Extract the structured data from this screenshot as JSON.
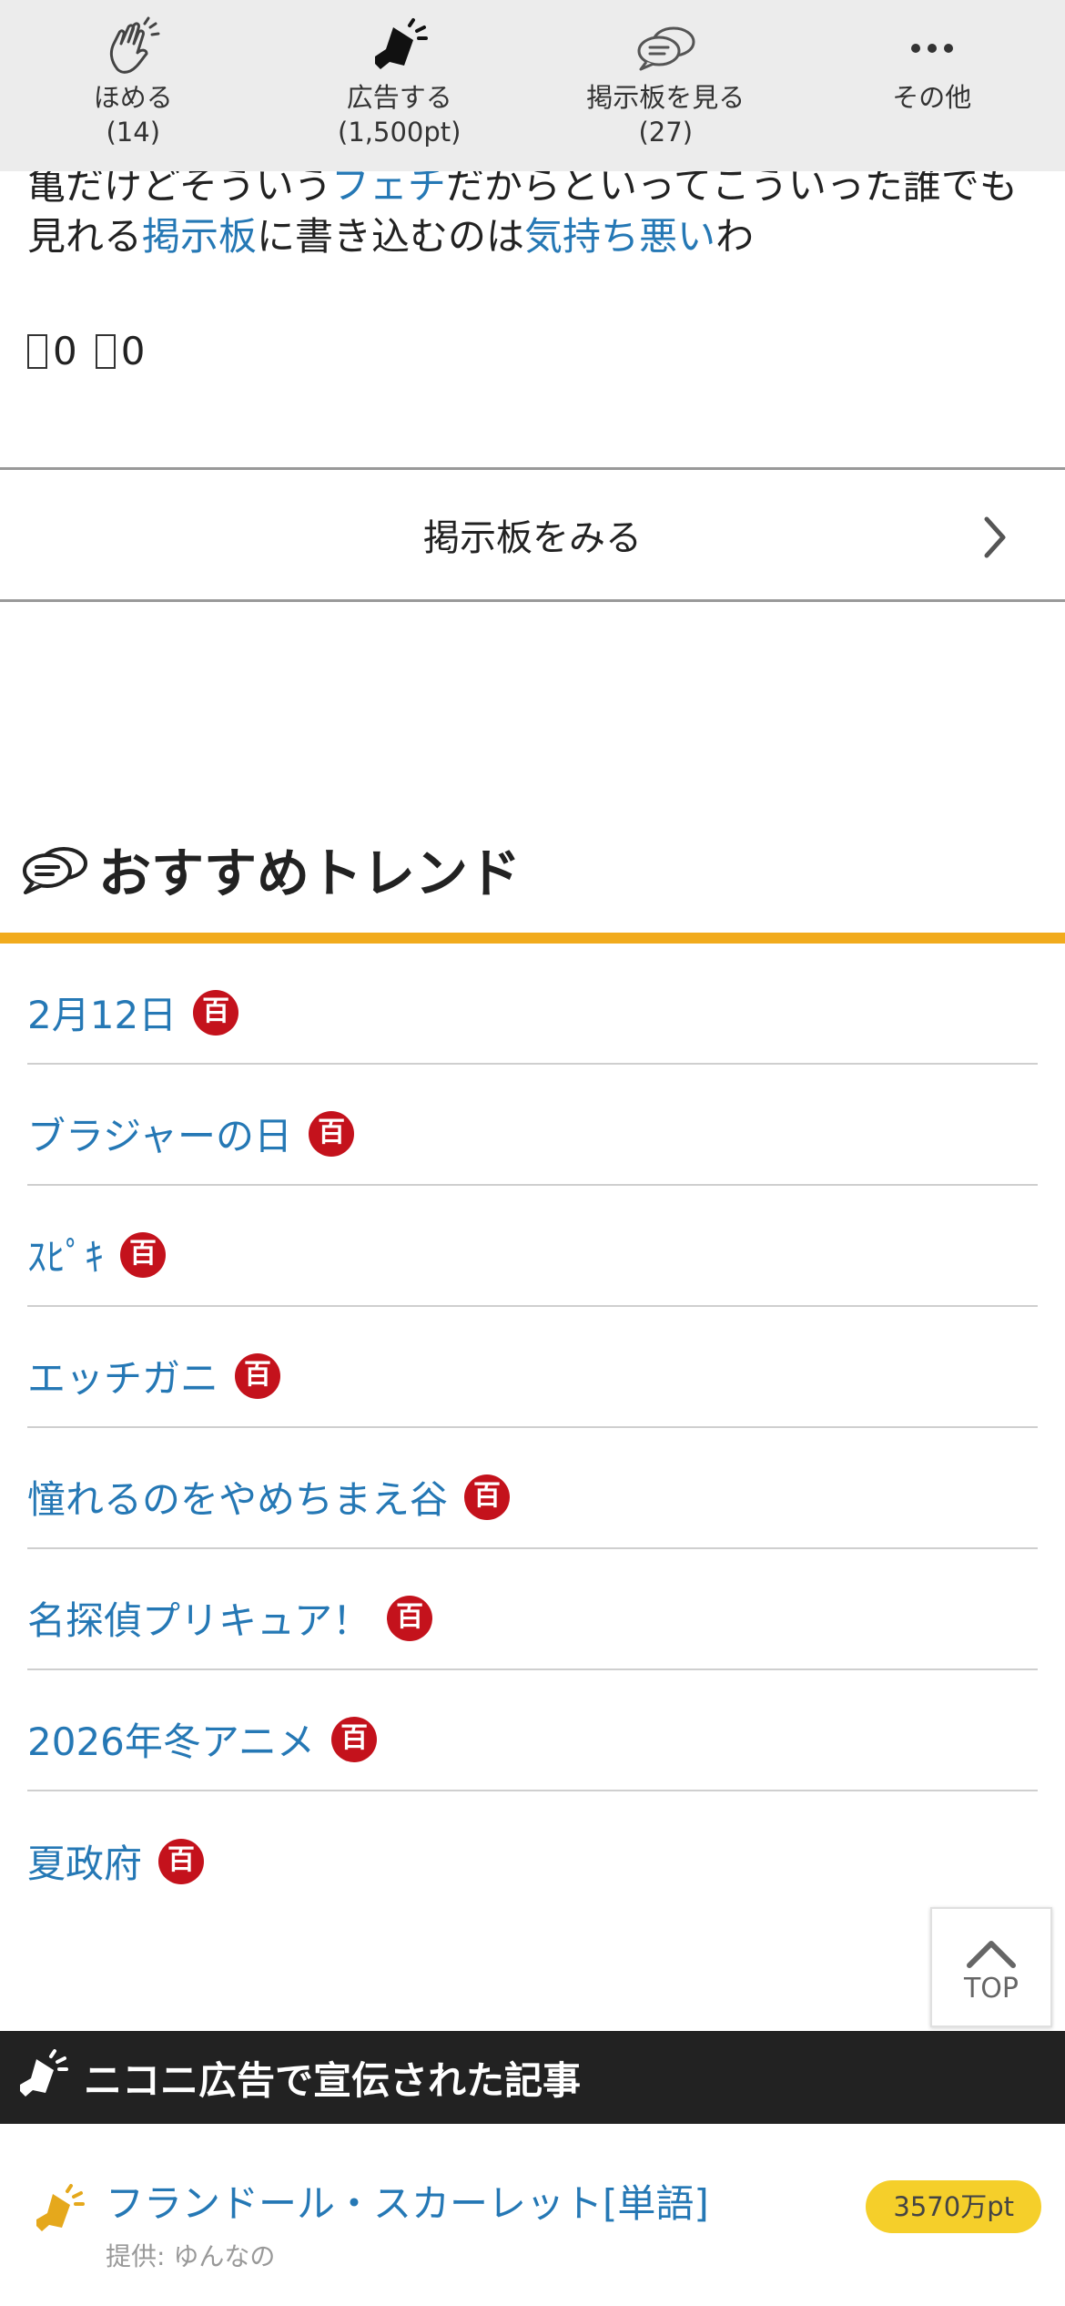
{
  "action_bar": {
    "praise": {
      "label": "ほめる",
      "count": "(14)"
    },
    "advertise": {
      "label": "広告する",
      "count": "(1,500pt)"
    },
    "bbs": {
      "label": "掲示板を見る",
      "count": "(27)"
    },
    "more": {
      "label": "その他"
    }
  },
  "article": {
    "line1_a": "亀だけどそういう",
    "line1_link": "フェチ",
    "line1_b": "だからといってこういった誰でも",
    "line2_a": "見れる",
    "line2_link1": "掲示板",
    "line2_b": "に書き込むのは",
    "line2_link2": "気持ち悪い",
    "line2_c": "わ",
    "upvotes": "0",
    "downvotes": "0"
  },
  "bbs_link": {
    "label": "掲示板をみる"
  },
  "trends": {
    "title": "おすすめトレンド",
    "items": [
      {
        "label": "2月12日"
      },
      {
        "label": "ブラジャーの日"
      },
      {
        "label": "ｽﾋﾟｷ"
      },
      {
        "label": "エッチガニ"
      },
      {
        "label": "憧れるのをやめちまえ谷"
      },
      {
        "label": "名探偵プリキュア！"
      },
      {
        "label": "2026年冬アニメ"
      },
      {
        "label": "夏政府"
      }
    ]
  },
  "top_button": {
    "label": "TOP"
  },
  "nico_ads": {
    "title": "ニコニ広告で宣伝された記事",
    "item": {
      "name": "フランドール・スカーレット[単語]",
      "sponsor": "提供: ゆんなの",
      "points": "3570万pt"
    }
  },
  "colors": {
    "link": "#2578b5",
    "accent_bar": "#f1ab1d",
    "badge_red": "#c4121c",
    "points_badge": "#f5cf2a",
    "dark_header": "#222222"
  }
}
